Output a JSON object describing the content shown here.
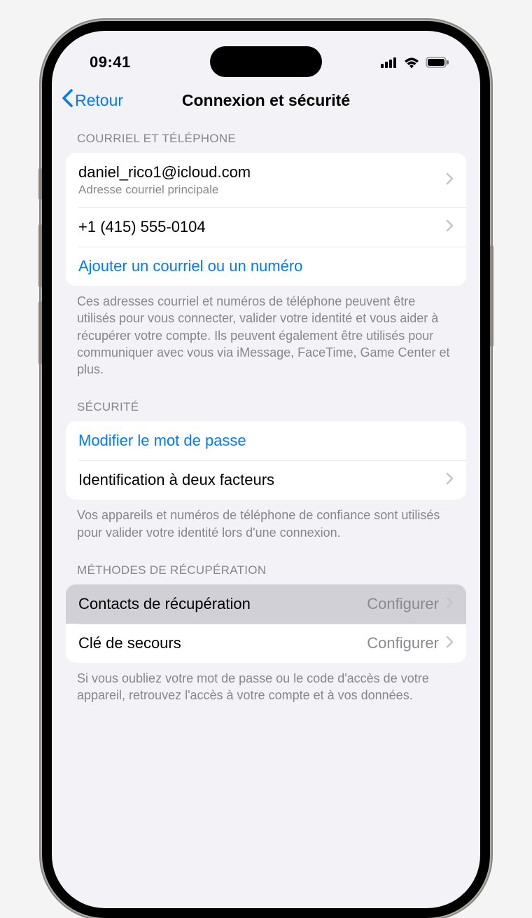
{
  "status_bar": {
    "time": "09:41"
  },
  "nav": {
    "back_label": "Retour",
    "title": "Connexion et sécurité"
  },
  "sections": {
    "email_phone": {
      "header": "COURRIEL ET TÉLÉPHONE",
      "email_value": "daniel_rico1@icloud.com",
      "email_sub": "Adresse courriel principale",
      "phone_value": "+1 (415) 555-0104",
      "add_label": "Ajouter un courriel ou un numéro",
      "footer": "Ces adresses courriel et numéros de téléphone peuvent être utilisés pour vous connecter, valider votre identité et vous aider à récupérer votre compte. Ils peuvent également être utilisés pour communiquer avec vous via iMessage, FaceTime, Game Center et plus."
    },
    "security": {
      "header": "SÉCURITÉ",
      "change_password": "Modifier le mot de passe",
      "two_factor": "Identification à deux facteurs",
      "footer": "Vos appareils et numéros de téléphone de confiance sont utilisés pour valider votre identité lors d'une connexion."
    },
    "recovery": {
      "header": "MÉTHODES DE RÉCUPÉRATION",
      "recovery_contacts": "Contacts de récupération",
      "recovery_key": "Clé de secours",
      "configure_label": "Configurer",
      "footer": "Si vous oubliez votre mot de passe ou le code d'accès de votre appareil, retrouvez l'accès à votre compte et à vos données."
    }
  }
}
